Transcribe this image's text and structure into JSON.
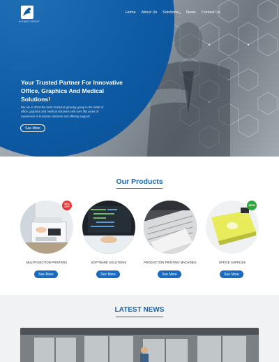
{
  "brand": {
    "logo_text": "ALFAHD GROUP"
  },
  "nav": {
    "items": [
      {
        "label": "Home",
        "has_dropdown": false
      },
      {
        "label": "About Us",
        "has_dropdown": false
      },
      {
        "label": "Solutions",
        "has_dropdown": true
      },
      {
        "label": "News",
        "has_dropdown": false
      },
      {
        "label": "Contact Us",
        "has_dropdown": false
      }
    ]
  },
  "hero": {
    "title": "Your Trusted Partner For Innovative Office, Graphics And Medical Solutions!",
    "description": "We are in 2019 the most trusted & growing group in the fields of office, graphics and medical solutions with over fifty years of experience in business solutions and offering support.",
    "button_label": "See More"
  },
  "products": {
    "title": "Our Products",
    "items": [
      {
        "name": "MULTIFUNCTION PRINTERS",
        "button_label": "See More",
        "badge": "50% OFF",
        "badge_color": "#e53935"
      },
      {
        "name": "SOFTWARE SOLUTIONS",
        "button_label": "See More",
        "badge": "",
        "badge_color": ""
      },
      {
        "name": "PRODUCTION PRINTING MACHINES",
        "button_label": "See More",
        "badge": "",
        "badge_color": ""
      },
      {
        "name": "OFFICE SUPPLIES",
        "button_label": "See More",
        "badge": "NEW",
        "badge_color": "#2eaa3c"
      }
    ]
  },
  "news": {
    "title": "LATEST NEWS"
  },
  "colors": {
    "primary": "#1565b4",
    "button": "#1a6bbd",
    "hero_blue": "#0d5aa4"
  }
}
